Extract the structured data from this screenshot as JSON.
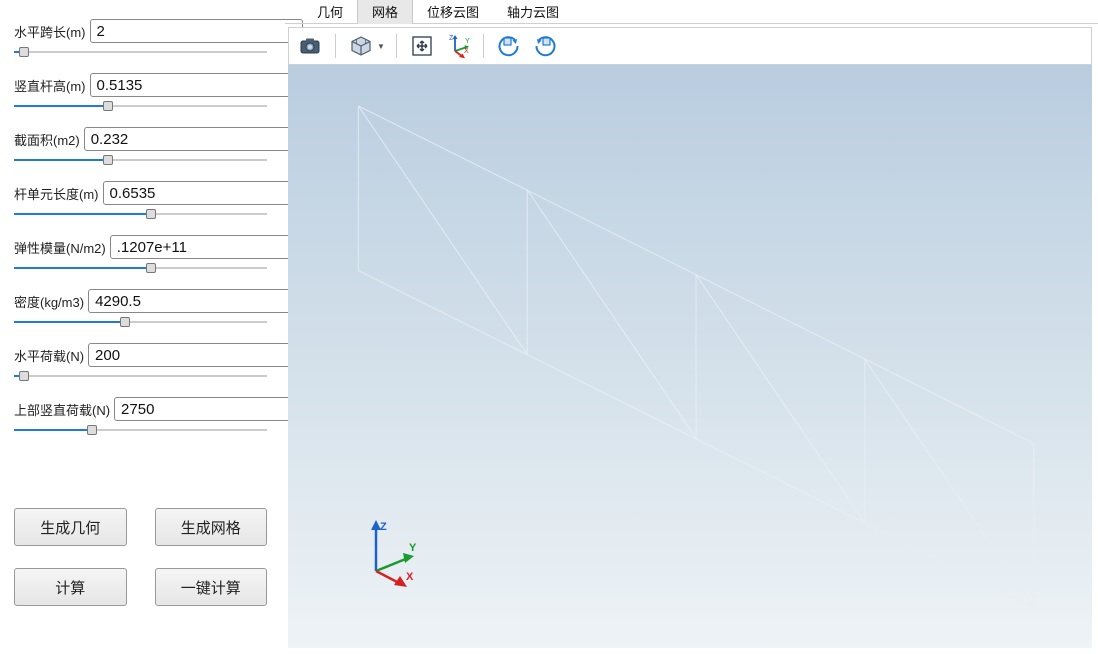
{
  "params": [
    {
      "label": "水平跨长(m)",
      "value": "2",
      "pct": 4
    },
    {
      "label": "竖直杆高(m)",
      "value": "0.5135",
      "pct": 37
    },
    {
      "label": "截面积(m2)",
      "value": "0.232",
      "pct": 37
    },
    {
      "label": "杆单元长度(m)",
      "value": "0.6535",
      "pct": 54
    },
    {
      "label": "弹性模量(N/m2)",
      "value": ".1207e+11",
      "pct": 54
    },
    {
      "label": "密度(kg/m3)",
      "value": "4290.5",
      "pct": 44
    },
    {
      "label": "水平荷载(N)",
      "value": "200",
      "pct": 4
    },
    {
      "label": "上部竖直荷载(N)",
      "value": "2750",
      "pct": 31
    }
  ],
  "buttons": {
    "gen_geom": "生成几何",
    "gen_mesh": "生成网格",
    "calc": "计算",
    "calc_all": "一键计算"
  },
  "tabs": [
    "几何",
    "网格",
    "位移云图",
    "轴力云图"
  ],
  "active_tab": 1,
  "triad": {
    "x": "X",
    "y": "Y",
    "z": "Z"
  }
}
